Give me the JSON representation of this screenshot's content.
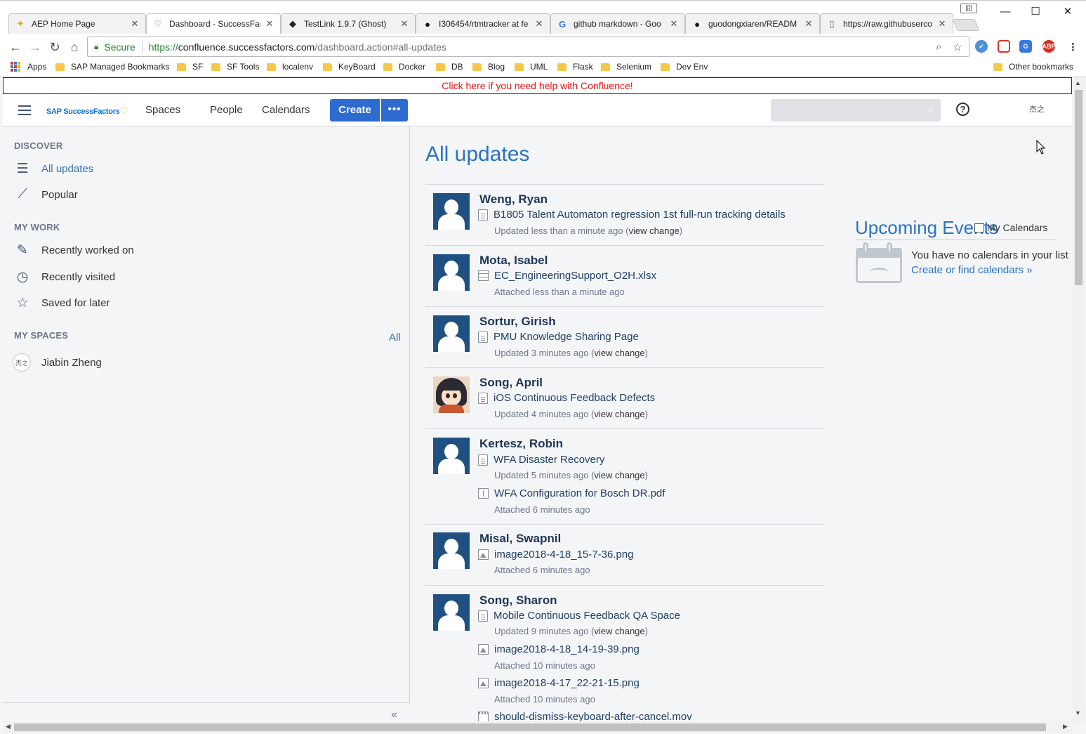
{
  "browser": {
    "tabs": [
      {
        "title": "AEP Home Page",
        "icon": "aep-icon"
      },
      {
        "title": "Dashboard - SuccessFact",
        "icon": "heart-icon"
      },
      {
        "title": "TestLink 1.9.7 (Ghost)",
        "icon": "testlink-icon"
      },
      {
        "title": "I306454/rtmtracker at fe",
        "icon": "github-icon"
      },
      {
        "title": "github markdown - Goo",
        "icon": "google-icon"
      },
      {
        "title": "guodongxiaren/READM",
        "icon": "github-icon"
      },
      {
        "title": "https://raw.githubuserco",
        "icon": "page-icon"
      }
    ],
    "profile_badge": "囧",
    "window_controls": {
      "minimize": "—",
      "maximize": "☐",
      "close": "✕"
    },
    "url": {
      "secure_label": "Secure",
      "scheme": "https://",
      "host": "confluence.successfactors.com",
      "path": "/dashboard.action#all-updates"
    },
    "extensions": {
      "abp": "ABP"
    },
    "bookmarks": [
      "Apps",
      "SAP Managed Bookmarks",
      "SF",
      "SF Tools",
      "localenv",
      "KeyBoard",
      "Docker",
      "DB",
      "Blog",
      "UML",
      "Flask",
      "Selenium",
      "Dev Env"
    ],
    "other_bookmarks": "Other bookmarks"
  },
  "confluence": {
    "help_banner": "Click here if you need help with Confluence!",
    "header": {
      "logo": "SAP SuccessFactors",
      "logo_mark": "♡",
      "nav": [
        "Spaces",
        "People",
        "Calendars"
      ],
      "create": "Create",
      "more": "•••",
      "help_icon": "?",
      "user_initials": "杰之"
    },
    "sidebar": {
      "discover_title": "DISCOVER",
      "discover": [
        {
          "label": "All updates",
          "icon": "list-icon"
        },
        {
          "label": "Popular",
          "icon": "trend-icon"
        }
      ],
      "mywork_title": "MY WORK",
      "mywork": [
        {
          "label": "Recently worked on",
          "icon": "edit-icon"
        },
        {
          "label": "Recently visited",
          "icon": "clock-icon"
        },
        {
          "label": "Saved for later",
          "icon": "star-icon"
        }
      ],
      "myspaces_title": "MY SPACES",
      "all_link": "All",
      "spaces": [
        {
          "label": "Jiabin Zheng",
          "avatar": "杰之"
        }
      ],
      "collapse": "«"
    },
    "main": {
      "title": "All updates",
      "feed": [
        {
          "author": "Weng, Ryan",
          "items": [
            {
              "type": "page",
              "title": "B1805 Talent Automaton regression 1st full-run tracking details",
              "meta": "Updated less than a minute ago (",
              "link": "view change",
              "close": ")"
            }
          ]
        },
        {
          "author": "Mota, Isabel",
          "items": [
            {
              "type": "sheet",
              "title": "EC_EngineeringSupport_O2H.xlsx",
              "meta": "Attached less than a minute ago",
              "link": "",
              "close": ""
            }
          ]
        },
        {
          "author": "Sortur, Girish",
          "items": [
            {
              "type": "page",
              "title": "PMU Knowledge Sharing Page",
              "meta": "Updated 3 minutes ago (",
              "link": "view change",
              "close": ")"
            }
          ]
        },
        {
          "author": "Song, April",
          "items": [
            {
              "type": "page",
              "title": "iOS Continuous Feedback Defects",
              "meta": "Updated 4 minutes ago (",
              "link": "view change",
              "close": ")"
            }
          ]
        },
        {
          "author": "Kertesz, Robin",
          "items": [
            {
              "type": "page",
              "title": "WFA Disaster Recovery",
              "meta": "Updated 5 minutes ago (",
              "link": "view change",
              "close": ")"
            },
            {
              "type": "pdf",
              "title": "WFA Configuration for Bosch DR.pdf",
              "meta": "Attached 6 minutes ago",
              "link": "",
              "close": ""
            }
          ]
        },
        {
          "author": "Misal, Swapnil",
          "items": [
            {
              "type": "image",
              "title": "image2018-4-18_15-7-36.png",
              "meta": "Attached 6 minutes ago",
              "link": "",
              "close": ""
            }
          ]
        },
        {
          "author": "Song, Sharon",
          "items": [
            {
              "type": "page",
              "title": "Mobile Continuous Feedback QA Space",
              "meta": "Updated 9 minutes ago (",
              "link": "view change",
              "close": ")"
            },
            {
              "type": "image",
              "title": "image2018-4-18_14-19-39.png",
              "meta": "Attached 10 minutes ago",
              "link": "",
              "close": ""
            },
            {
              "type": "image",
              "title": "image2018-4-17_22-21-15.png",
              "meta": "Attached 10 minutes ago",
              "link": "",
              "close": ""
            },
            {
              "type": "video",
              "title": "should-dismiss-keyboard-after-cancel.mov",
              "meta": "",
              "link": "",
              "close": ""
            }
          ]
        }
      ]
    },
    "events": {
      "title": "Upcoming Events",
      "my_calendars": "My Calendars",
      "empty_text": "You have no calendars in your list",
      "find_link": "Create or find calendars »"
    },
    "colors": {
      "accent": "#2d6bd0",
      "link": "#3572b0",
      "title": "#2a73c2",
      "avatar_bg": "#205081",
      "help_text": "#e01616"
    }
  }
}
